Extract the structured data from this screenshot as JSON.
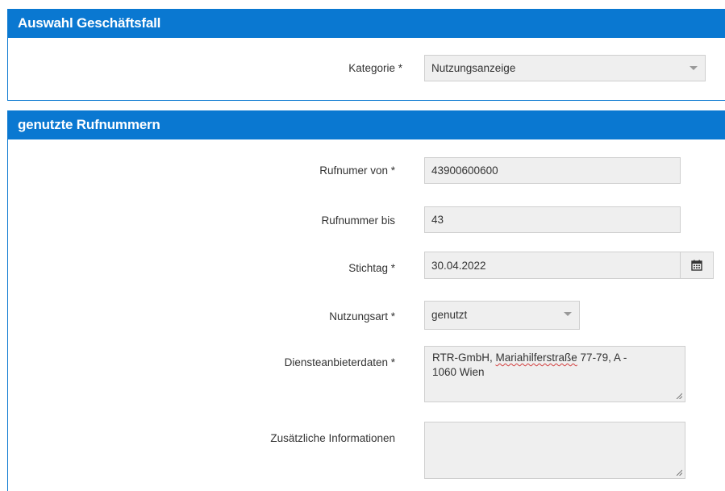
{
  "section1": {
    "title": "Auswahl Geschäftsfall",
    "kategorie_label": "Kategorie *",
    "kategorie_value": "Nutzungsanzeige"
  },
  "section2": {
    "title": "genutzte Rufnummern",
    "rufnummer_von_label": "Rufnumer von *",
    "rufnummer_von_value": "43900600600",
    "rufnummer_bis_label": "Rufnummer bis",
    "rufnummer_bis_value": "43",
    "stichtag_label": "Stichtag *",
    "stichtag_value": "30.04.2022",
    "nutzungsart_label": "Nutzungsart *",
    "nutzungsart_value": "genutzt",
    "diensteanbieter_label": "Diensteanbieterdaten *",
    "diensteanbieter_value_part1": "RTR-GmbH, ",
    "diensteanbieter_value_misspelled": "Mariahilferstraße",
    "diensteanbieter_value_part2": " 77-79, A -",
    "diensteanbieter_value_line2": "1060 Wien",
    "zusatz_label": "Zusätzliche Informationen",
    "zusatz_value": ""
  },
  "icons": {
    "calendar": "calendar-icon",
    "dropdown": "chevron-down-icon",
    "resize": "resize-handle-icon"
  },
  "colors": {
    "header_blue": "#0a78d1",
    "field_bg": "#efefef"
  }
}
